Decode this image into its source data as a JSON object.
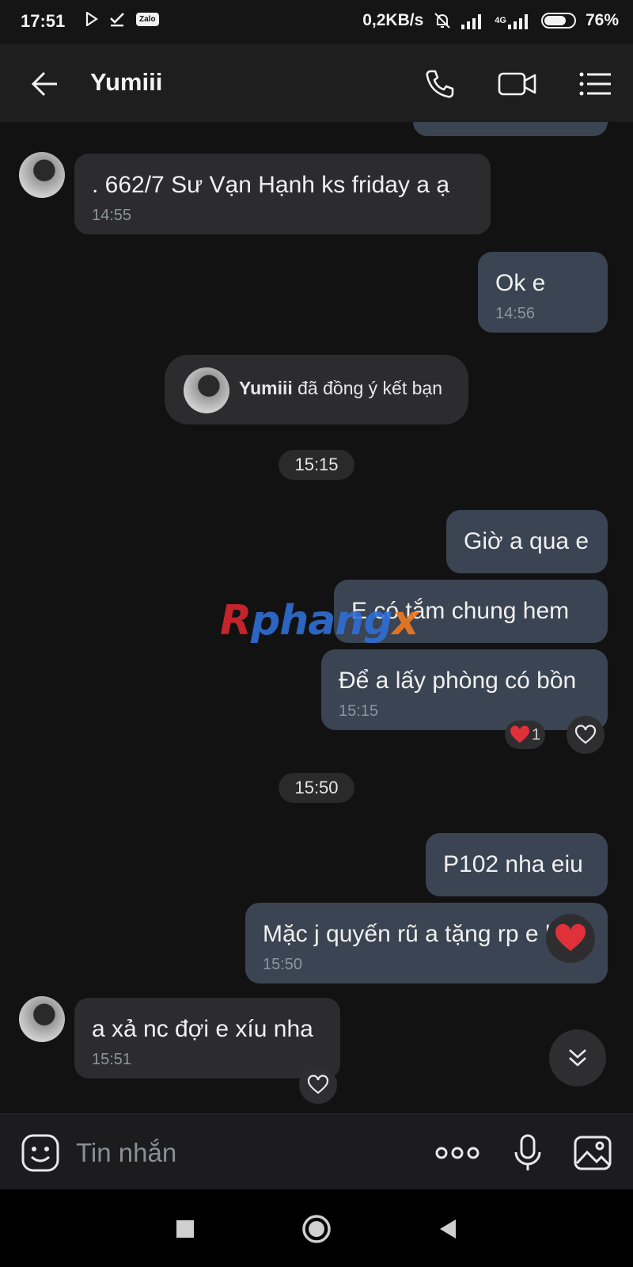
{
  "status_bar": {
    "time": "17:51",
    "network_speed": "0,2KB/s",
    "network_type": "4G",
    "battery": "76%",
    "zalo_label": "Zalo"
  },
  "header": {
    "title": "Yumiii"
  },
  "messages": [
    {
      "id": 1,
      "direction": "in",
      "text": ". 662/7 Sư Vạn Hạnh ks friday a ạ",
      "time": "14:55"
    },
    {
      "id": 2,
      "direction": "out",
      "text": "Ok e",
      "time": "14:56"
    },
    {
      "id": 3,
      "direction": "out",
      "text": "Giờ a qua e",
      "time": ""
    },
    {
      "id": 4,
      "direction": "out",
      "text": "E có tắm chung hem",
      "time": ""
    },
    {
      "id": 5,
      "direction": "out",
      "text": "Để a lấy phòng có bồn",
      "time": "15:15"
    },
    {
      "id": 6,
      "direction": "out",
      "text": "P102 nha eiu",
      "time": ""
    },
    {
      "id": 7,
      "direction": "out",
      "text": "Mặc j quyến rũ a tặng rp e he",
      "time": "15:50"
    },
    {
      "id": 8,
      "direction": "in",
      "text": "a xả nc đợi e xíu nha",
      "time": "15:51"
    }
  ],
  "system_notice": {
    "name": "Yumiii",
    "text": "đã đồng ý kết bạn"
  },
  "date_pills": [
    "15:15",
    "15:50"
  ],
  "reaction": {
    "emoji": "❤️",
    "count": "1"
  },
  "watermark": {
    "part1": "R",
    "part2": "phang",
    "part3": "x"
  },
  "input": {
    "placeholder": "Tin nhắn"
  },
  "colors": {
    "background": "#121212",
    "incoming_bubble": "#2c2c2e",
    "outgoing_bubble": "#3a4452",
    "heart": "#e0303a"
  }
}
